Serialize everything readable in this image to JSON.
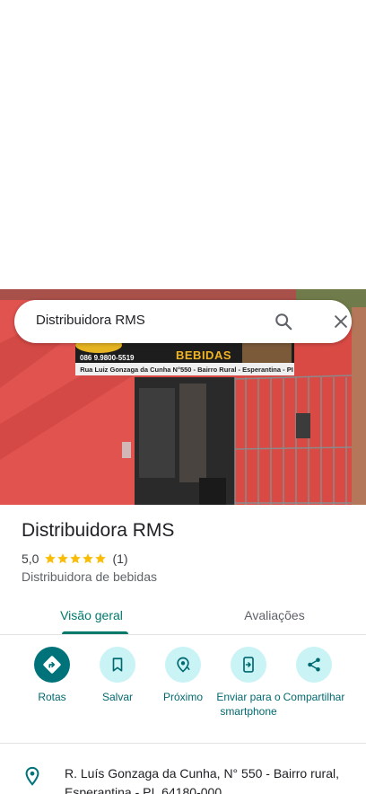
{
  "search": {
    "query": "Distribuidora RMS"
  },
  "photo": {
    "sign_contact": "086 9.9800-5519",
    "sign_title": "BEBIDAS",
    "sign_address": "Rua Luiz Gonzaga da Cunha N°550 - Bairro Rural - Esperantina - PI"
  },
  "place": {
    "name": "Distribuidora RMS",
    "rating": "5,0",
    "stars": 5,
    "review_count": "(1)",
    "category": "Distribuidora de bebidas"
  },
  "tabs": [
    {
      "label": "Visão geral",
      "active": true
    },
    {
      "label": "Avaliações",
      "active": false
    }
  ],
  "actions": [
    {
      "label": "Rotas",
      "icon": "directions-icon"
    },
    {
      "label": "Salvar",
      "icon": "bookmark-icon"
    },
    {
      "label": "Próximo",
      "icon": "nearby-icon"
    },
    {
      "label": "Enviar para o smartphone",
      "icon": "send-to-phone-icon"
    },
    {
      "label": "Compartilhar",
      "icon": "share-icon"
    }
  ],
  "address": {
    "text": "R. Luís Gonzaga da Cunha, N° 550 - Bairro rural, Esperantina - PI, 64180-000"
  },
  "colors": {
    "accent": "#00796b",
    "action_bg": "#c9f3f5",
    "action_primary": "#00737a",
    "star": "#fbbc04"
  }
}
